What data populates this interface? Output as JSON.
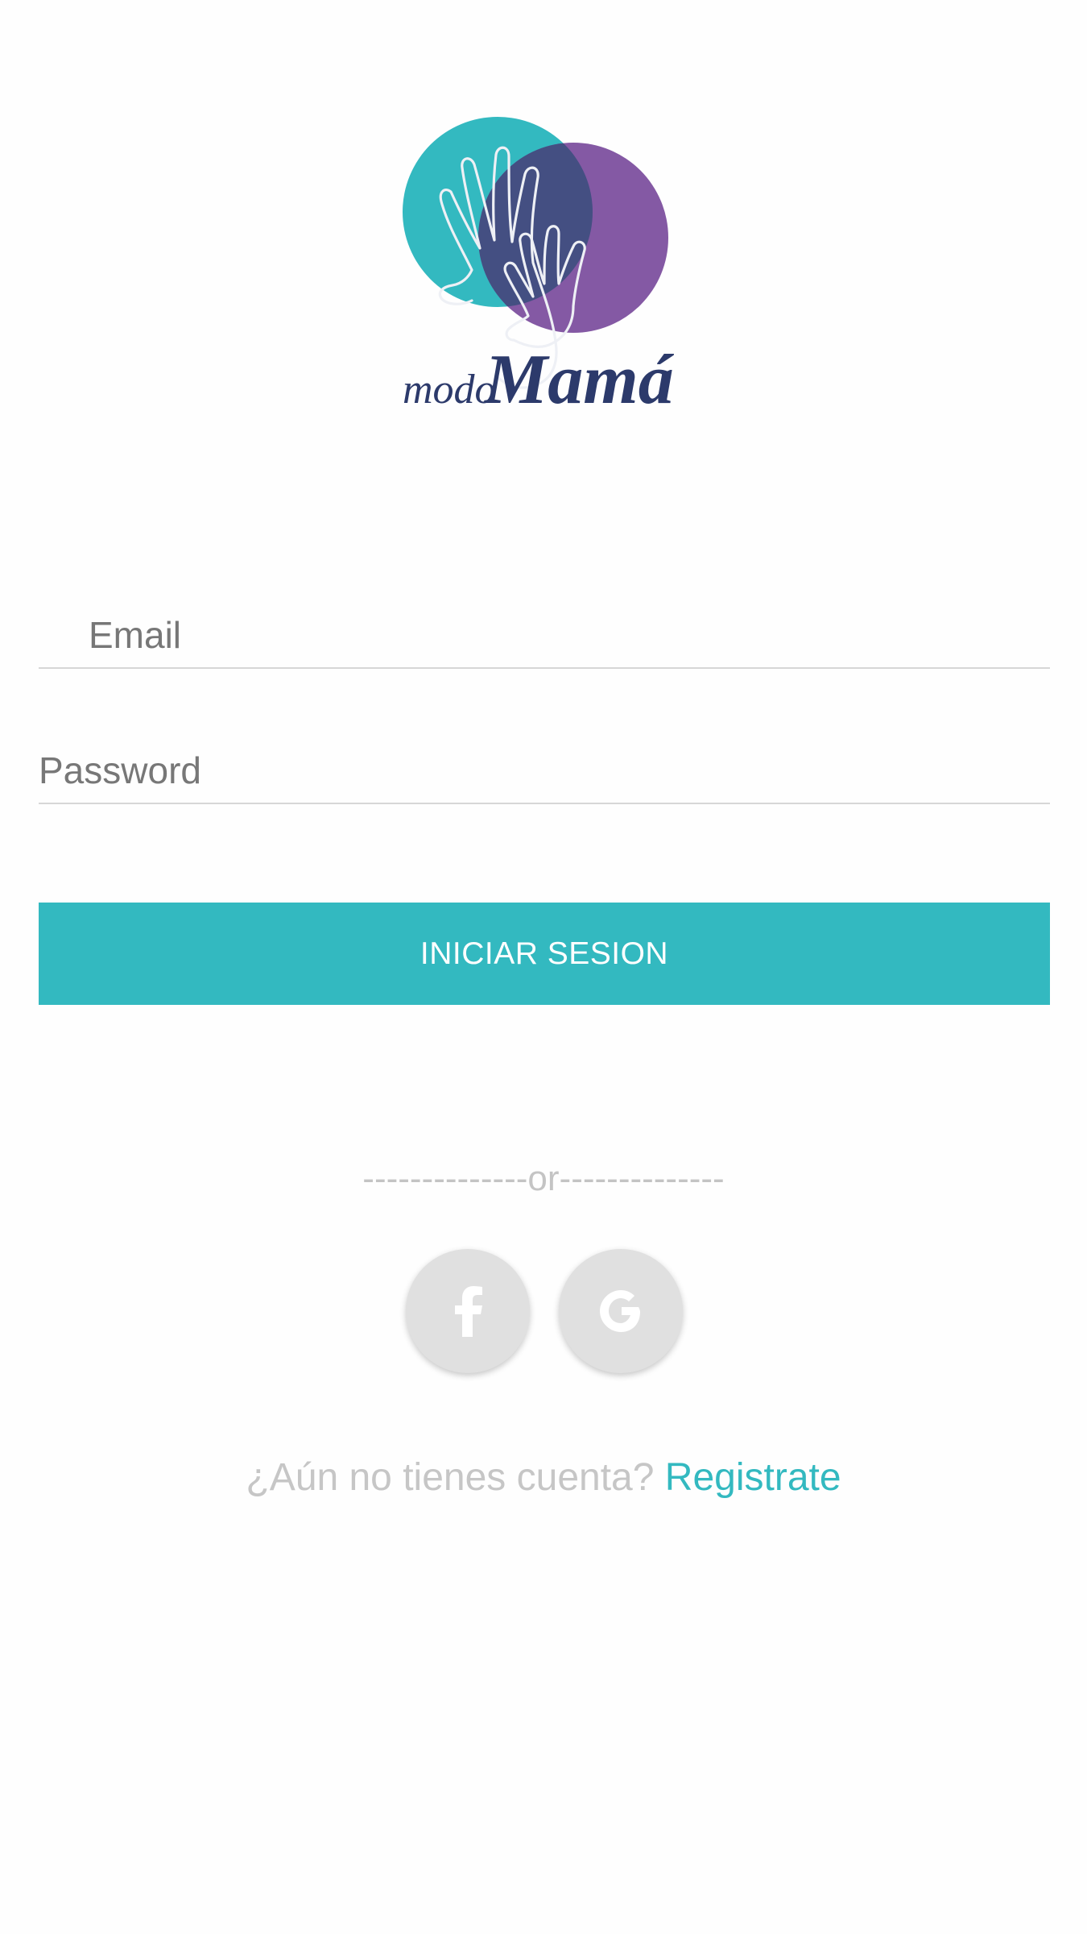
{
  "logo": {
    "text_modo": "modo",
    "text_mama": "Mamá",
    "colors": {
      "teal": "#33b9c0",
      "purple": "#8459a4",
      "navy": "#2c3a6b"
    }
  },
  "login_form": {
    "email_placeholder": "Email",
    "password_placeholder": "Password",
    "submit_label": "INICIAR SESION"
  },
  "divider": {
    "text": "--------------or--------------"
  },
  "social": {
    "facebook_icon": "facebook-icon",
    "google_icon": "google-icon",
    "facebook_glyph": "f",
    "google_glyph": "G"
  },
  "signup": {
    "prompt": "¿Aún no tienes cuenta?",
    "link_label": "Registrate"
  },
  "colors": {
    "accent": "#33b9c0",
    "muted_text": "#c4c4c4",
    "input_text": "#777777",
    "social_bg": "#e0e0e0"
  }
}
